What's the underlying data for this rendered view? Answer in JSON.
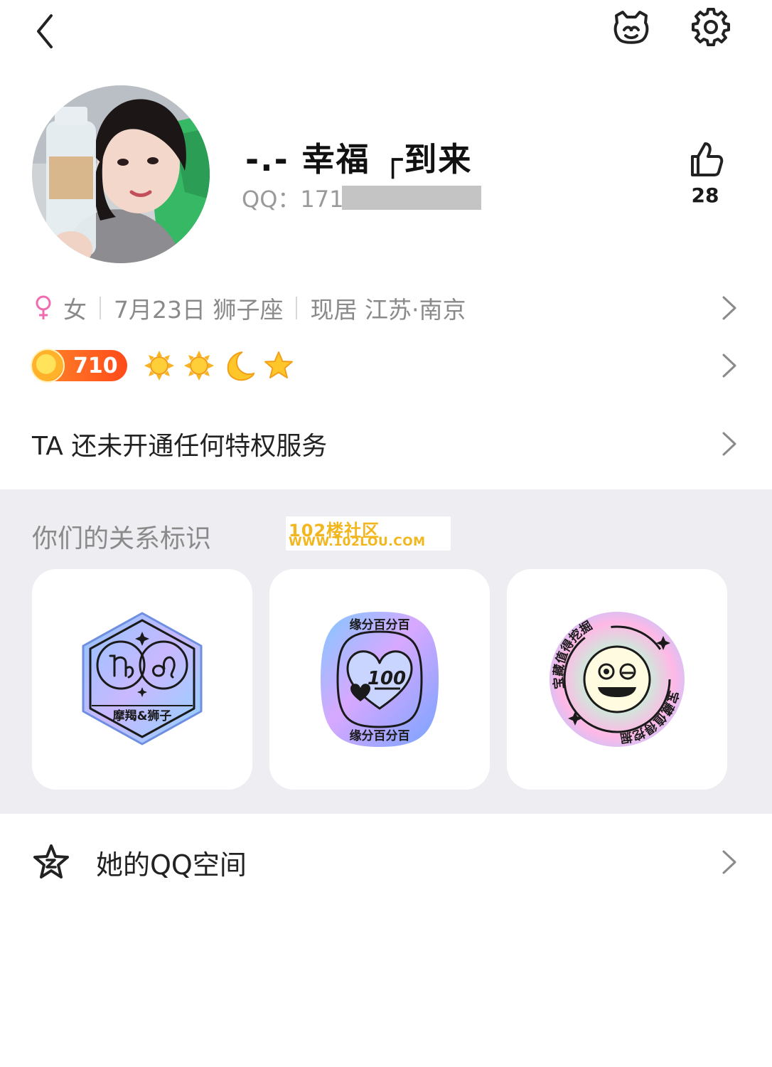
{
  "topbar": {
    "back_icon": "chevron-left-icon",
    "pet_icon": "pet-face-icon",
    "settings_icon": "gear-icon"
  },
  "profile": {
    "nickname": "-.- 幸福 ┌到来",
    "qq_label": "QQ：171",
    "likes": "28",
    "like_icon": "thumbs-up-icon"
  },
  "info": {
    "gender_icon": "female-icon",
    "gender": "女",
    "birthday": "7月23日 狮子座",
    "location": "现居 江苏·南京"
  },
  "level": {
    "value": "710",
    "icons": [
      "sun-icon",
      "sun-icon",
      "moon-icon",
      "star-icon"
    ]
  },
  "privilege": {
    "text": "TA 还未开通任何特权服务"
  },
  "relation": {
    "title": "你们的关系标识",
    "watermark_line1": "102楼社区",
    "watermark_line2": "WWW.102LOU.COM",
    "badges": [
      {
        "name": "zodiac-badge",
        "label": "摩羯&狮子"
      },
      {
        "name": "match-badge",
        "label": "缘分百分百",
        "number": "100"
      },
      {
        "name": "treasure-badge",
        "label": "宝藏值得挖掘"
      }
    ]
  },
  "qzone": {
    "icon": "qzone-star-icon",
    "label": "她的QQ空间"
  },
  "colors": {
    "section_bg": "#eeeef2",
    "female_pink": "#f06bb0",
    "level_orange": "#ff6a20",
    "watermark_yellow": "#f2b61e"
  }
}
